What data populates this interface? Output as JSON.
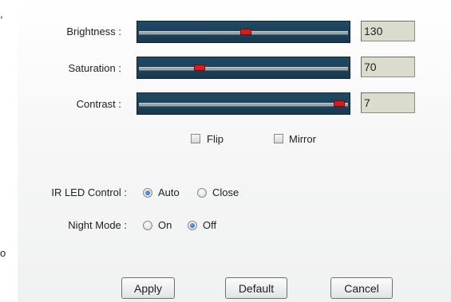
{
  "clipped_left_text": {
    "top": ",",
    "bottom": "o"
  },
  "image_settings": {
    "brightness": {
      "label": "Brightness :",
      "value": "130",
      "level": 0.51
    },
    "saturation": {
      "label": "Saturation :",
      "value": "70",
      "level": 0.28
    },
    "contrast": {
      "label": "Contrast :",
      "value": "7",
      "level": 0.98
    }
  },
  "orientation": {
    "flip": {
      "label": "Flip",
      "checked": false
    },
    "mirror": {
      "label": "Mirror",
      "checked": false
    }
  },
  "ir_led_control": {
    "label": "IR LED Control :",
    "options": [
      {
        "label": "Auto",
        "checked": true
      },
      {
        "label": "Close",
        "checked": false
      }
    ]
  },
  "night_mode": {
    "label": "Night Mode :",
    "options": [
      {
        "label": "On",
        "checked": false
      },
      {
        "label": "Off",
        "checked": true
      }
    ]
  },
  "buttons": {
    "apply": "Apply",
    "default": "Default",
    "cancel": "Cancel"
  },
  "colors": {
    "slider_bg": "#1f4a63",
    "thumb": "#d41d1d",
    "value_box": "#dcdcce"
  }
}
